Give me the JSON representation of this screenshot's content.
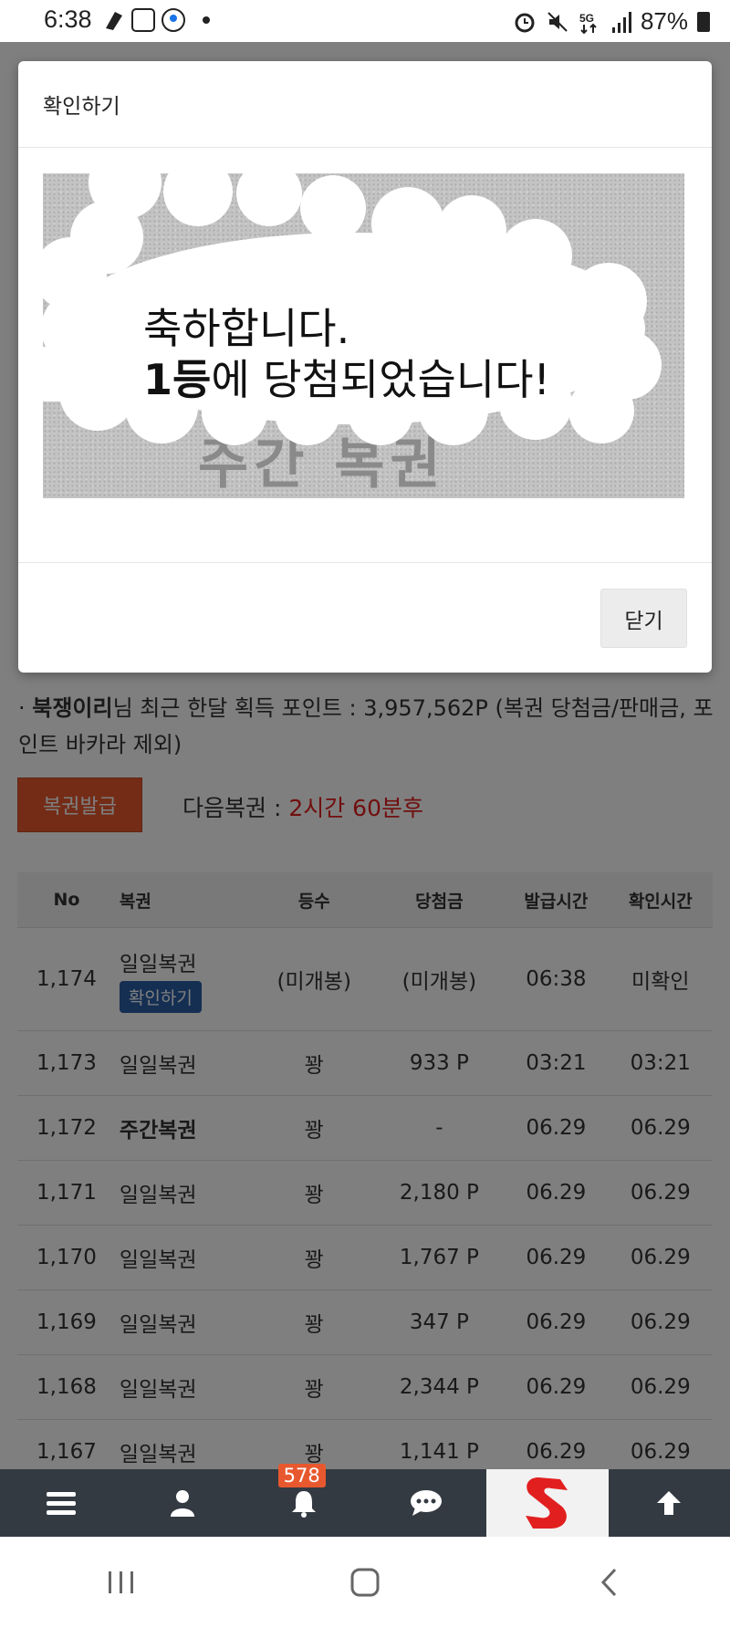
{
  "status_bar": {
    "time": "6:38",
    "battery": "87%",
    "network": "5G"
  },
  "page": {
    "points_user": "북쟁이리",
    "points_text": "님 최근 한달 획득 포인트 : 3,957,562P (복권 당첨금/판매금, 포인트 바카라 제외)",
    "issue_button": "복권발급",
    "next_label": "다음복권 : ",
    "next_time": "2시간 60분후",
    "table": {
      "headers": [
        "No",
        "복권",
        "등수",
        "당첨금",
        "발급시간",
        "확인시간"
      ],
      "rows": [
        {
          "no": "1,174",
          "ticket": "일일복권",
          "chip": "확인하기",
          "rank": "(미개봉)",
          "prize": "(미개봉)",
          "issued": "06:38",
          "checked": "미확인"
        },
        {
          "no": "1,173",
          "ticket": "일일복권",
          "rank": "꽝",
          "prize": "933 P",
          "issued": "03:21",
          "checked": "03:21"
        },
        {
          "no": "1,172",
          "ticket": "주간복권",
          "rank": "꽝",
          "prize": "-",
          "issued": "06.29",
          "checked": "06.29"
        },
        {
          "no": "1,171",
          "ticket": "일일복권",
          "rank": "꽝",
          "prize": "2,180 P",
          "issued": "06.29",
          "checked": "06.29"
        },
        {
          "no": "1,170",
          "ticket": "일일복권",
          "rank": "꽝",
          "prize": "1,767 P",
          "issued": "06.29",
          "checked": "06.29"
        },
        {
          "no": "1,169",
          "ticket": "일일복권",
          "rank": "꽝",
          "prize": "347 P",
          "issued": "06.29",
          "checked": "06.29"
        },
        {
          "no": "1,168",
          "ticket": "일일복권",
          "rank": "꽝",
          "prize": "2,344 P",
          "issued": "06.29",
          "checked": "06.29"
        },
        {
          "no": "1,167",
          "ticket": "일일복권",
          "rank": "꽝",
          "prize": "1,141 P",
          "issued": "06.29",
          "checked": "06.29"
        }
      ]
    }
  },
  "modal": {
    "title": "확인하기",
    "hidden_text": "주간 복권",
    "message_line1": "축하합니다.",
    "message_rank": "1등",
    "message_line2": "에 당첨되었습니다!",
    "close_label": "닫기"
  },
  "bottom_nav": {
    "notification_count": "578",
    "items": [
      "menu-icon",
      "user-icon",
      "bell-icon",
      "chat-icon",
      "logo",
      "arrow-up-icon"
    ]
  }
}
